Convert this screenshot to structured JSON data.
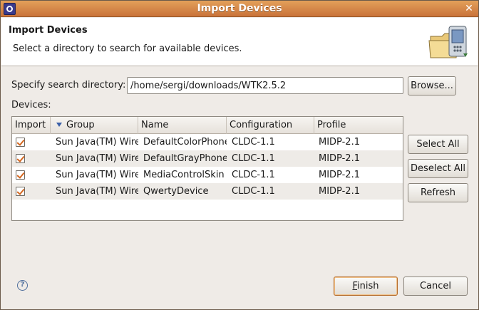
{
  "window": {
    "title": "Import Devices"
  },
  "banner": {
    "heading": "Import Devices",
    "description": "Select a directory to search for available devices.",
    "icon": "device-folder-icon"
  },
  "search": {
    "label": "Specify search directory:",
    "value": "/home/sergi/downloads/WTK2.5.2",
    "browse_label": "Browse..."
  },
  "devices": {
    "label": "Devices:",
    "columns": [
      "Import",
      "Group",
      "Name",
      "Configuration",
      "Profile"
    ],
    "rows": [
      {
        "import": true,
        "group": "Sun Java(TM) Wirel",
        "name": "DefaultColorPhone",
        "configuration": "CLDC-1.1",
        "profile": "MIDP-2.1"
      },
      {
        "import": true,
        "group": "Sun Java(TM) Wirel",
        "name": "DefaultGrayPhone",
        "configuration": "CLDC-1.1",
        "profile": "MIDP-2.1"
      },
      {
        "import": true,
        "group": "Sun Java(TM) Wirel",
        "name": "MediaControlSkin",
        "configuration": "CLDC-1.1",
        "profile": "MIDP-2.1"
      },
      {
        "import": true,
        "group": "Sun Java(TM) Wirel",
        "name": "QwertyDevice",
        "configuration": "CLDC-1.1",
        "profile": "MIDP-2.1"
      }
    ]
  },
  "side_buttons": {
    "select_all": "Select All",
    "deselect_all": "Deselect All",
    "refresh": "Refresh"
  },
  "footer": {
    "finish_mnemonic": "F",
    "finish_rest": "inish",
    "cancel": "Cancel",
    "help_glyph": "?"
  },
  "colors": {
    "titlebar": "#d88a48",
    "accent": "#d4661e",
    "row_alt": "#eeebe7"
  }
}
